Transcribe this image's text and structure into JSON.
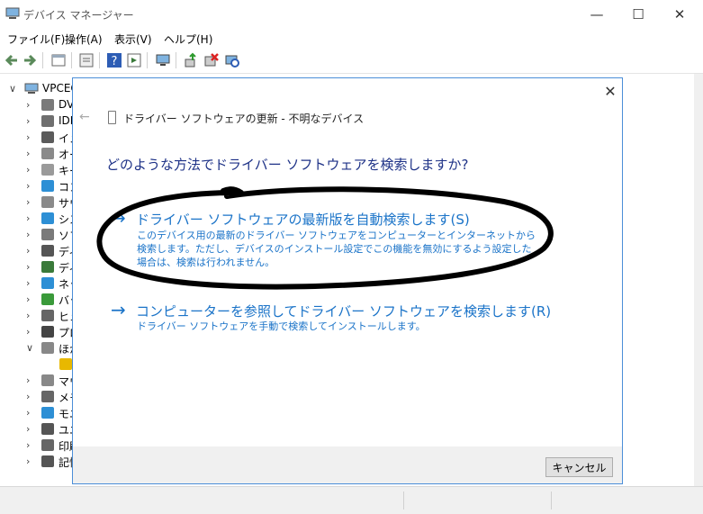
{
  "window": {
    "title": "デバイス マネージャー",
    "minimize": "—",
    "maximize": "☐",
    "close": "✕"
  },
  "menu": [
    "ファイル(F)",
    "操作(A)",
    "表示(V)",
    "ヘルプ(H)"
  ],
  "toolbar_icons": [
    "back-icon",
    "forward-icon",
    "properties-icon",
    "help-icon",
    "view-icon",
    "monitor-icon",
    "update-driver-icon",
    "uninstall-icon",
    "scan-icon"
  ],
  "tree": {
    "root_label": "VPCEG",
    "items": [
      {
        "label": "DV",
        "icon": "dvd-icon",
        "color": "#7a7a7a"
      },
      {
        "label": "IDE",
        "icon": "ide-icon",
        "color": "#6f6f6f"
      },
      {
        "label": "イメ",
        "icon": "imaging-icon",
        "color": "#5b5b5b"
      },
      {
        "label": "オー",
        "icon": "audio-icon",
        "color": "#8a8a8a"
      },
      {
        "label": "キー",
        "icon": "keyboard-icon",
        "color": "#9a9a9a"
      },
      {
        "label": "コン",
        "icon": "computer-icon",
        "color": "#2d8fd5"
      },
      {
        "label": "サウ",
        "icon": "sound-icon",
        "color": "#8a8a8a"
      },
      {
        "label": "シス",
        "icon": "system-icon",
        "color": "#2d8fd5"
      },
      {
        "label": "ソフ",
        "icon": "software-icon",
        "color": "#7a7a7a"
      },
      {
        "label": "ディ",
        "icon": "disk-icon",
        "color": "#555555"
      },
      {
        "label": "ディ",
        "icon": "display-icon",
        "color": "#3a7a3a"
      },
      {
        "label": "ネッ",
        "icon": "network-icon",
        "color": "#2d8fd5"
      },
      {
        "label": "バッ",
        "icon": "battery-icon",
        "color": "#3a9a3a"
      },
      {
        "label": "ヒュ",
        "icon": "hid-icon",
        "color": "#666666"
      },
      {
        "label": "プロ",
        "icon": "processor-icon",
        "color": "#444444"
      },
      {
        "label": "ほか",
        "icon": "other-device-icon",
        "color": "#888888"
      },
      {
        "label": "",
        "icon": "unknown-device-icon",
        "color": "#e8b800"
      },
      {
        "label": "マウ",
        "icon": "mouse-icon",
        "color": "#888888"
      },
      {
        "label": "メモ",
        "icon": "memory-icon",
        "color": "#666666"
      },
      {
        "label": "モニ",
        "icon": "monitor-icon",
        "color": "#2d8fd5"
      },
      {
        "label": "ユニ",
        "icon": "usb-icon",
        "color": "#555555"
      },
      {
        "label": "印刷",
        "icon": "print-queue-icon",
        "color": "#666666"
      },
      {
        "label": "記憶",
        "icon": "storage-icon",
        "color": "#555555"
      }
    ]
  },
  "dialog": {
    "title": "ドライバー ソフトウェアの更新 - 不明なデバイス",
    "question": "どのような方法でドライバー ソフトウェアを検索しますか?",
    "option_auto": {
      "arrow": "→",
      "title": "ドライバー ソフトウェアの最新版を自動検索します(S)",
      "desc": "このデバイス用の最新のドライバー ソフトウェアをコンピューターとインターネットから検索します。ただし、デバイスのインストール設定でこの機能を無効にするよう設定した場合は、検索は行われません。"
    },
    "option_browse": {
      "arrow": "→",
      "title": "コンピューターを参照してドライバー ソフトウェアを検索します(R)",
      "desc": "ドライバー ソフトウェアを手動で検索してインストールします。"
    },
    "cancel_label": "キャンセル",
    "close": "✕",
    "back": "←"
  },
  "colors": {
    "accent": "#1a73c8",
    "question": "#1e3287",
    "dialog_border": "#4b8ed8"
  }
}
